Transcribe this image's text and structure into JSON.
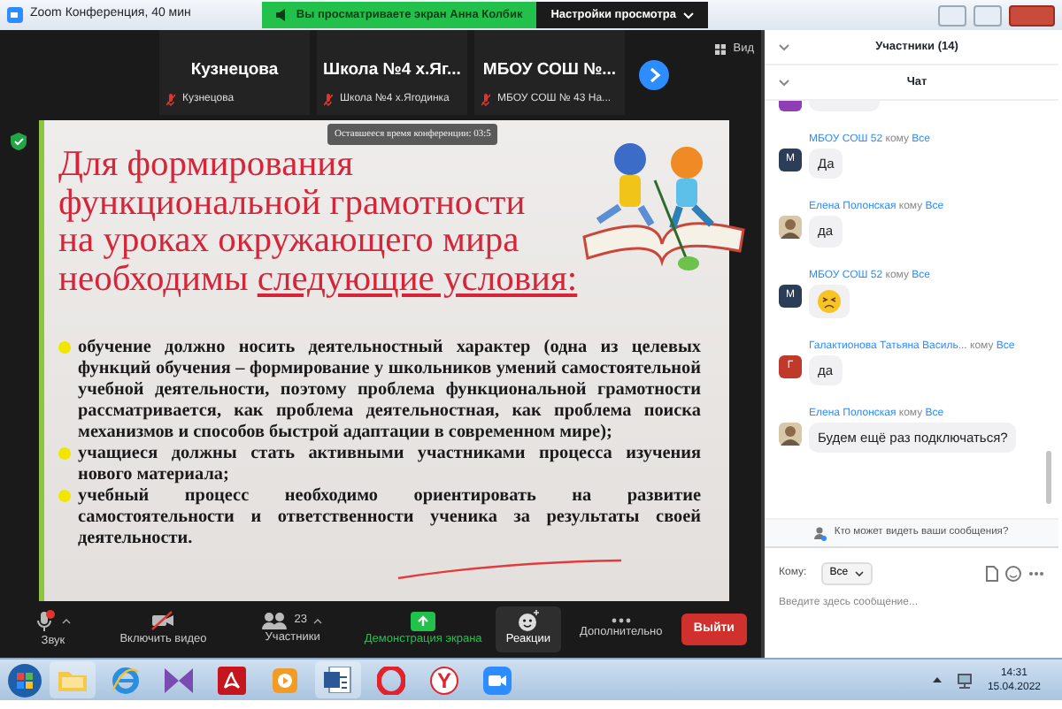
{
  "window": {
    "title": "Zoom Конференция, 40 мин",
    "share_banner": "Вы просматриваете экран Анна Колбик",
    "view_options": "Настройки просмотра"
  },
  "video_strip": {
    "tiles": [
      {
        "name": "Кузнецова",
        "label": "Кузнецова",
        "muted": true
      },
      {
        "name": "Школа №4 х.Яг...",
        "label": "Школа №4 х.Ягодинка",
        "muted": true
      },
      {
        "name": "МБОУ СОШ №...",
        "label": "МБОУ СОШ № 43 На...",
        "muted": true
      }
    ],
    "view_button": "Вид"
  },
  "shared_screen": {
    "timer_tooltip": "Оставшееся время конференции: 03:5",
    "slide": {
      "title_lines": [
        "Для формирования",
        "функциональной  грамотности",
        "на уроках окружающего мира"
      ],
      "title_last_lead": "необходимы",
      "title_last_underlined": "следующие условия:",
      "bullets": [
        "обучение должно носить деятельностный характер (одна из целевых функций обучения – формирование у школьников умений самостоятельной учебной деятельности, поэтому проблема функциональной грамотности рассматривается, как проблема деятельностная, как проблема поиска механизмов и способов быстрой адаптации в современном мире);",
        "учащиеся должны стать активными участниками процесса изучения нового материала;",
        "учебный процесс необходимо ориентировать на развитие самостоятельности и ответственности ученика за результаты своей деятельности."
      ]
    }
  },
  "toolbar": {
    "items": [
      {
        "kind": "audio",
        "label": "Звук",
        "muted": true
      },
      {
        "kind": "video",
        "label": "Включить видео",
        "muted": true
      },
      {
        "kind": "participants",
        "label": "Участники",
        "count": "23"
      },
      {
        "kind": "share",
        "label": "Демонстрация экрана"
      },
      {
        "kind": "reactions",
        "label": "Реакции",
        "highlighted": true
      },
      {
        "kind": "more",
        "label": "Дополнительно"
      }
    ],
    "leave_button": "Выйти"
  },
  "panel": {
    "participants_header": "Участники (14)",
    "chat_header": "Чат",
    "messages": [
      {
        "kind": "partial",
        "avatar": {
          "kind": "initial",
          "color": "#8e3fb5"
        }
      },
      {
        "kind": "text",
        "sender": "МБОУ СОШ 52",
        "to_word": "кому",
        "to": "Все",
        "avatar": {
          "kind": "initial",
          "letter": "М",
          "color": "#2c3e57"
        },
        "text": "Да"
      },
      {
        "kind": "text",
        "sender": "Елена Полонская",
        "to_word": "кому",
        "to": "Все",
        "avatar": {
          "kind": "photo"
        },
        "text": "да"
      },
      {
        "kind": "emoji",
        "sender": "МБОУ СОШ 52",
        "to_word": "кому",
        "to": "Все",
        "avatar": {
          "kind": "initial",
          "letter": "М",
          "color": "#2c3e57"
        }
      },
      {
        "kind": "text",
        "sender": "Галактионова Татьяна Василь...",
        "to_word": "кому",
        "to": "Все",
        "avatar": {
          "kind": "initial",
          "letter": "Г",
          "color": "#c0392b"
        },
        "text": "да"
      },
      {
        "kind": "text",
        "sender": "Елена Полонская",
        "to_word": "кому",
        "to": "Все",
        "avatar": {
          "kind": "photo"
        },
        "text": "Будем ещё раз подключаться?"
      }
    ],
    "visibility_note": "Кто может видеть ваши сообщения?",
    "recipient_label": "Кому:",
    "recipient": "Все",
    "input": {
      "placeholder": "Введите здесь сообщение..."
    }
  },
  "taskbar": {
    "apps": [
      {
        "kind": "folder"
      },
      {
        "kind": "ie"
      },
      {
        "kind": "bowtie"
      },
      {
        "kind": "pdf"
      },
      {
        "kind": "player"
      },
      {
        "kind": "word"
      },
      {
        "kind": "opera"
      },
      {
        "kind": "yandex",
        "glyph": "Y"
      },
      {
        "kind": "zoom"
      }
    ],
    "clock": {
      "time": "14:31",
      "date": "15.04.2022"
    }
  }
}
